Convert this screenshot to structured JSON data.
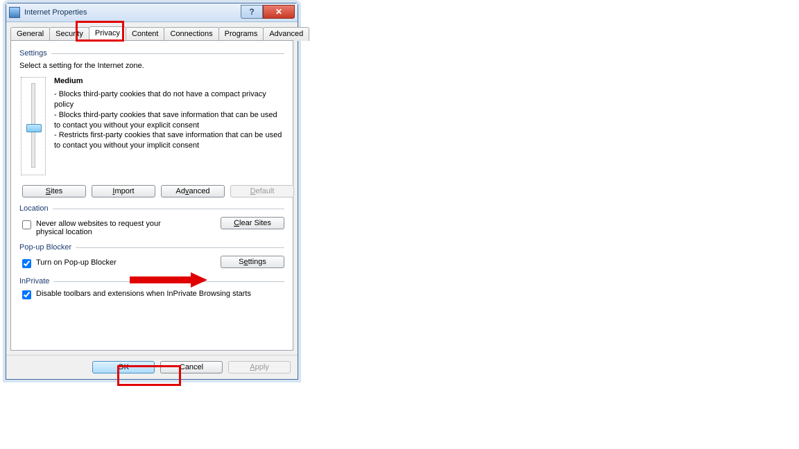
{
  "window": {
    "title": "Internet Properties"
  },
  "tabs": [
    "General",
    "Security",
    "Privacy",
    "Content",
    "Connections",
    "Programs",
    "Advanced"
  ],
  "active_tab": "Privacy",
  "settings": {
    "group": "Settings",
    "instruction": "Select a setting for the Internet zone.",
    "level_name": "Medium",
    "level_text": "- Blocks third-party cookies that do not have a compact privacy policy\n- Blocks third-party cookies that save information that can be used to contact you without your explicit consent\n- Restricts first-party cookies that save information that can be used to contact you without your implicit consent",
    "buttons": {
      "sites": "Sites",
      "import": "Import",
      "advanced": "Advanced",
      "default": "Default"
    }
  },
  "location": {
    "group": "Location",
    "never_allow": "Never allow websites to request your physical location",
    "clear_sites": "Clear Sites"
  },
  "popup": {
    "group": "Pop-up Blocker",
    "turn_on": "Turn on Pop-up Blocker",
    "settings": "Settings"
  },
  "inprivate": {
    "group": "InPrivate",
    "disable_toolbars": "Disable toolbars and extensions when InPrivate Browsing starts"
  },
  "footer": {
    "ok": "OK",
    "cancel": "Cancel",
    "apply": "Apply"
  }
}
